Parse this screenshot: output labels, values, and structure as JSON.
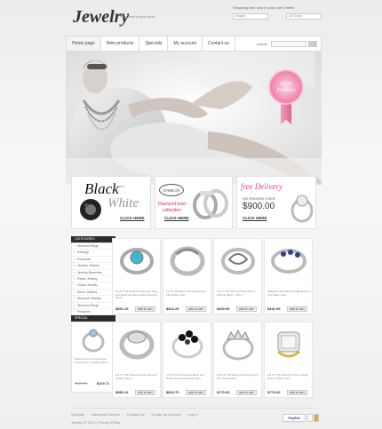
{
  "header": {
    "logo": "Jewelry",
    "tagline": "the best jewels store",
    "cart_text": "Shopping cart:",
    "cart_items": "now in your cart 0 items",
    "language": "English",
    "currency": "US Dollar"
  },
  "nav": {
    "items": [
      "Home page",
      "New products",
      "Specials",
      "My account",
      "Contact us"
    ],
    "search_label": "search"
  },
  "hero": {
    "badge_line1": "NEW",
    "badge_line2": "Product"
  },
  "promos": [
    {
      "title1": "Black",
      "title2": "White",
      "small": "and",
      "cta": "CLICK HERE"
    },
    {
      "seal": "EVERLON",
      "caption1": "Diamond knot",
      "caption2": "collection",
      "cta": "CLICK HERE"
    },
    {
      "title": "free Delivery",
      "sub": "ON ORDERS OVER",
      "amount": "$900.00",
      "cta": "CLICK HERE"
    }
  ],
  "sidebar": {
    "categories_title": "CATEGORIES",
    "categories": [
      "Diamond Rings",
      "Earrings",
      "Pendants",
      "Jewelry Jewelry",
      "Jewelry Bracelets",
      "Pearls Jewelry",
      "Charm Jewelry",
      "Men's Jewelry",
      "Diamond Jewelry",
      "Diamond Rings",
      "Pendants"
    ],
    "special_title": "SPECIAL",
    "special_desc": "Diamond cut and Marquise Stone Ring in Sterling Silver",
    "special_old": "$169.90",
    "special_new": "$119.71"
  },
  "products_row1": [
    {
      "desc": "1/2 CT TW Hamilton Diamond Hoop and White Rhodium Plated Sterling Silver",
      "price": "$851.10",
      "btn": "add to cart"
    },
    {
      "desc": "1/4 CT TW Diamond Swirl Ring in 10K White Gold",
      "price": "$524.25",
      "btn": "add to cart"
    },
    {
      "desc": "1/4 CT TW Diamond Knot Ring in Sterling Silver - Size 7",
      "price": "$409.99",
      "btn": "add to cart"
    },
    {
      "desc": "Sapphire and Diamond Wild Band in 10K White Gold",
      "price": "$431.99",
      "btn": "add to cart"
    }
  ],
  "products_row2": [
    {
      "desc": "1/4 CT TW Diamond Lady Glamour Fashion Ring",
      "price": "$889.14",
      "btn": "add to cart"
    },
    {
      "desc": "1/4 CT TW Enhanced Black and White Diamond Fashion Ring",
      "price": "$823.70",
      "btn": "add to cart"
    },
    {
      "desc": "1/10 CT TW Diamond Tiara Ring in 10K White Gold",
      "price": "$770.00",
      "btn": "add to cart"
    },
    {
      "desc": "1/2 CT TW Diamond Three Cluster Ring in White Gold",
      "price": "$770.00",
      "btn": "add to cart"
    }
  ],
  "footer": {
    "links": [
      "Specials",
      "Advanced Search",
      "Contact Us",
      "Create an Account",
      "Log In"
    ],
    "copyright": "Jewelry © 2011 | Privacy Policy",
    "paypal": "PayPal"
  },
  "colors": {
    "accent": "#d0266a",
    "dark": "#2b2b2b"
  }
}
